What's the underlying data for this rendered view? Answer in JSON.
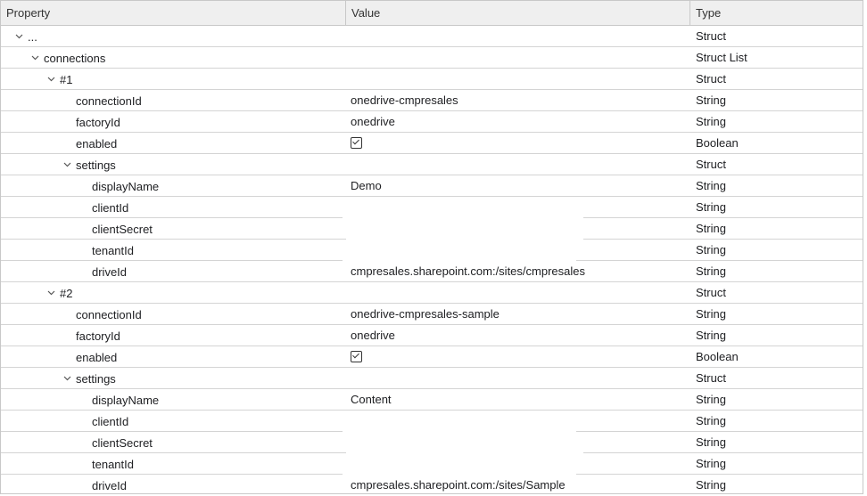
{
  "columns": {
    "property": "Property",
    "value": "Value",
    "type": "Type"
  },
  "rows": [
    {
      "level": 0,
      "expanded": true,
      "name": "...",
      "value": "",
      "type": "Struct"
    },
    {
      "level": 1,
      "expanded": true,
      "name": "connections",
      "value": "",
      "type": "Struct List"
    },
    {
      "level": 2,
      "expanded": true,
      "name": "#1",
      "value": "",
      "type": "Struct"
    },
    {
      "level": 3,
      "expanded": null,
      "name": "connectionId",
      "value": "onedrive-cmpresales",
      "type": "String"
    },
    {
      "level": 3,
      "expanded": null,
      "name": "factoryId",
      "value": "onedrive",
      "type": "String"
    },
    {
      "level": 3,
      "expanded": null,
      "name": "enabled",
      "value": "",
      "checkbox": true,
      "checked": true,
      "type": "Boolean"
    },
    {
      "level": 3,
      "expanded": true,
      "name": "settings",
      "value": "",
      "type": "Struct"
    },
    {
      "level": 4,
      "expanded": null,
      "name": "displayName",
      "value": "Demo",
      "type": "String"
    },
    {
      "level": 4,
      "expanded": null,
      "name": "clientId",
      "value": "",
      "type": "String"
    },
    {
      "level": 4,
      "expanded": null,
      "name": "clientSecret",
      "value": "",
      "type": "String"
    },
    {
      "level": 4,
      "expanded": null,
      "name": "tenantId",
      "value": "",
      "type": "String"
    },
    {
      "level": 4,
      "expanded": null,
      "name": "driveId",
      "value": "cmpresales.sharepoint.com:/sites/cmpresales",
      "type": "String"
    },
    {
      "level": 2,
      "expanded": true,
      "name": "#2",
      "value": "",
      "type": "Struct"
    },
    {
      "level": 3,
      "expanded": null,
      "name": "connectionId",
      "value": "onedrive-cmpresales-sample",
      "type": "String"
    },
    {
      "level": 3,
      "expanded": null,
      "name": "factoryId",
      "value": "onedrive",
      "type": "String"
    },
    {
      "level": 3,
      "expanded": null,
      "name": "enabled",
      "value": "",
      "checkbox": true,
      "checked": true,
      "type": "Boolean"
    },
    {
      "level": 3,
      "expanded": true,
      "name": "settings",
      "value": "",
      "type": "Struct"
    },
    {
      "level": 4,
      "expanded": null,
      "name": "displayName",
      "value": "Content",
      "type": "String"
    },
    {
      "level": 4,
      "expanded": null,
      "name": "clientId",
      "value": "",
      "type": "String"
    },
    {
      "level": 4,
      "expanded": null,
      "name": "clientSecret",
      "value": "",
      "type": "String"
    },
    {
      "level": 4,
      "expanded": null,
      "name": "tenantId",
      "value": "",
      "type": "String"
    },
    {
      "level": 4,
      "expanded": null,
      "name": "driveId",
      "value": "cmpresales.sharepoint.com:/sites/Sample",
      "type": "String"
    }
  ]
}
